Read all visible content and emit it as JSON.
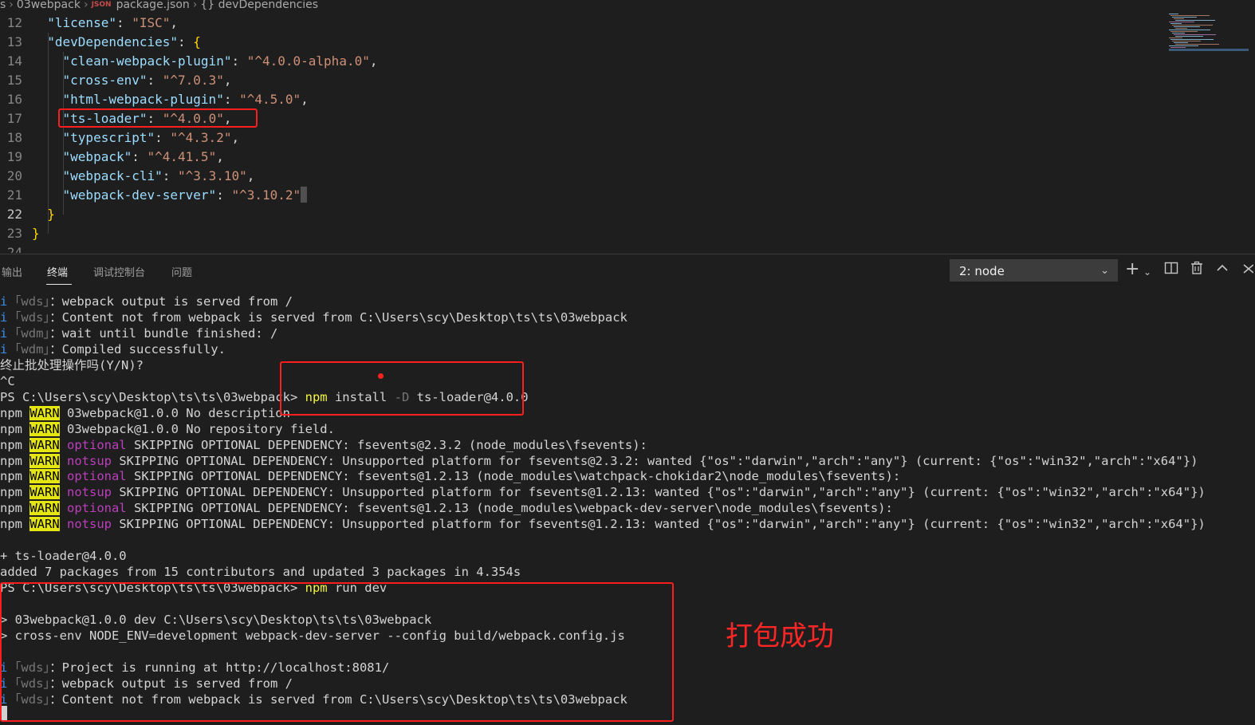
{
  "breadcrumb": {
    "seg1": "s",
    "seg2": "03webpack",
    "file_icon": "JSON",
    "file": "package.json",
    "node_icon": "{}",
    "node": "devDependencies"
  },
  "editor": {
    "lines": [
      {
        "n": "12",
        "code": [
          [
            "k",
            "  \"license\""
          ],
          [
            "p",
            ": "
          ],
          [
            "s",
            "\"ISC\""
          ],
          [
            "p",
            ","
          ]
        ]
      },
      {
        "n": "13",
        "code": [
          [
            "k",
            "  \"devDependencies\""
          ],
          [
            "p",
            ": "
          ],
          [
            "b",
            "{"
          ]
        ]
      },
      {
        "n": "14",
        "code": [
          [
            "k",
            "    \"clean-webpack-plugin\""
          ],
          [
            "p",
            ": "
          ],
          [
            "s",
            "\"^4.0.0-alpha.0\""
          ],
          [
            "p",
            ","
          ]
        ]
      },
      {
        "n": "15",
        "code": [
          [
            "k",
            "    \"cross-env\""
          ],
          [
            "p",
            ": "
          ],
          [
            "s",
            "\"^7.0.3\""
          ],
          [
            "p",
            ","
          ]
        ]
      },
      {
        "n": "16",
        "code": [
          [
            "k",
            "    \"html-webpack-plugin\""
          ],
          [
            "p",
            ": "
          ],
          [
            "s",
            "\"^4.5.0\""
          ],
          [
            "p",
            ","
          ]
        ]
      },
      {
        "n": "17",
        "code": [
          [
            "k",
            "    \"ts-loader\""
          ],
          [
            "p",
            ": "
          ],
          [
            "s",
            "\"^4.0.0\""
          ],
          [
            "p",
            ","
          ]
        ]
      },
      {
        "n": "18",
        "code": [
          [
            "k",
            "    \"typescript\""
          ],
          [
            "p",
            ": "
          ],
          [
            "s",
            "\"^4.3.2\""
          ],
          [
            "p",
            ","
          ]
        ]
      },
      {
        "n": "19",
        "code": [
          [
            "k",
            "    \"webpack\""
          ],
          [
            "p",
            ": "
          ],
          [
            "s",
            "\"^4.41.5\""
          ],
          [
            "p",
            ","
          ]
        ]
      },
      {
        "n": "20",
        "code": [
          [
            "k",
            "    \"webpack-cli\""
          ],
          [
            "p",
            ": "
          ],
          [
            "s",
            "\"^3.3.10\""
          ],
          [
            "p",
            ","
          ]
        ]
      },
      {
        "n": "21",
        "code": [
          [
            "k",
            "    \"webpack-dev-server\""
          ],
          [
            "p",
            ": "
          ],
          [
            "s",
            "\"^3.10.2\""
          ]
        ]
      },
      {
        "n": "22",
        "code": [
          [
            "p",
            "  "
          ],
          [
            "b",
            "}"
          ]
        ]
      },
      {
        "n": "23",
        "code": [
          [
            "b",
            "}"
          ]
        ]
      },
      {
        "n": "24",
        "code": []
      }
    ]
  },
  "panel": {
    "tabs": [
      "输出",
      "终端",
      "调试控制台",
      "问题"
    ],
    "active_tab": "终端",
    "terminal_select": "2: node",
    "icons": [
      "plus-icon",
      "chevron-down-icon",
      "split-terminal-icon",
      "trash-icon",
      "chevron-up-icon",
      "close-icon"
    ]
  },
  "terminal": {
    "lines": [
      [
        [
          "info",
          "i"
        ],
        [
          "dim",
          " ｢wds｣"
        ],
        [
          "",
          "：webpack output is served from /"
        ]
      ],
      [
        [
          "info",
          "i"
        ],
        [
          "dim",
          " ｢wds｣"
        ],
        [
          "",
          "：Content not from webpack is served from C:\\Users\\scy\\Desktop\\ts\\ts\\03webpack"
        ]
      ],
      [
        [
          "info",
          "i"
        ],
        [
          "dim",
          " ｢wdm｣"
        ],
        [
          "",
          "：wait until bundle finished: /"
        ]
      ],
      [
        [
          "info",
          "i"
        ],
        [
          "dim",
          " ｢wdm｣"
        ],
        [
          "",
          "：Compiled successfully."
        ]
      ],
      [
        [
          "",
          "终止批处理操作吗(Y/N)?"
        ]
      ],
      [
        [
          "",
          "^C"
        ]
      ],
      [
        [
          "",
          "PS C:\\Users\\scy\\Desktop\\ts\\ts\\03webpack> "
        ],
        [
          "yel",
          "npm"
        ],
        [
          "",
          " install "
        ],
        [
          "dim",
          "-D"
        ],
        [
          "",
          " ts-loader@4.0.0"
        ]
      ],
      [
        [
          "",
          "npm "
        ],
        [
          "warnbg",
          "WARN"
        ],
        [
          "",
          " 03webpack@1.0.0 No description"
        ]
      ],
      [
        [
          "",
          "npm "
        ],
        [
          "warnbg",
          "WARN"
        ],
        [
          "",
          " 03webpack@1.0.0 No repository field."
        ]
      ],
      [
        [
          "",
          "npm "
        ],
        [
          "warnbg",
          "WARN"
        ],
        [
          "opt",
          " optional"
        ],
        [
          "",
          " SKIPPING OPTIONAL DEPENDENCY: fsevents@2.3.2 (node_modules\\fsevents):"
        ]
      ],
      [
        [
          "",
          "npm "
        ],
        [
          "warnbg",
          "WARN"
        ],
        [
          "opt",
          " notsup"
        ],
        [
          "",
          " SKIPPING OPTIONAL DEPENDENCY: Unsupported platform for fsevents@2.3.2: wanted {\"os\":\"darwin\",\"arch\":\"any\"} (current: {\"os\":\"win32\",\"arch\":\"x64\"})"
        ]
      ],
      [
        [
          "",
          "npm "
        ],
        [
          "warnbg",
          "WARN"
        ],
        [
          "opt",
          " optional"
        ],
        [
          "",
          " SKIPPING OPTIONAL DEPENDENCY: fsevents@1.2.13 (node_modules\\watchpack-chokidar2\\node_modules\\fsevents):"
        ]
      ],
      [
        [
          "",
          "npm "
        ],
        [
          "warnbg",
          "WARN"
        ],
        [
          "opt",
          " notsup"
        ],
        [
          "",
          " SKIPPING OPTIONAL DEPENDENCY: Unsupported platform for fsevents@1.2.13: wanted {\"os\":\"darwin\",\"arch\":\"any\"} (current: {\"os\":\"win32\",\"arch\":\"x64\"})"
        ]
      ],
      [
        [
          "",
          "npm "
        ],
        [
          "warnbg",
          "WARN"
        ],
        [
          "opt",
          " optional"
        ],
        [
          "",
          " SKIPPING OPTIONAL DEPENDENCY: fsevents@1.2.13 (node_modules\\webpack-dev-server\\node_modules\\fsevents):"
        ]
      ],
      [
        [
          "",
          "npm "
        ],
        [
          "warnbg",
          "WARN"
        ],
        [
          "opt",
          " notsup"
        ],
        [
          "",
          " SKIPPING OPTIONAL DEPENDENCY: Unsupported platform for fsevents@1.2.13: wanted {\"os\":\"darwin\",\"arch\":\"any\"} (current: {\"os\":\"win32\",\"arch\":\"x64\"})"
        ]
      ],
      [],
      [
        [
          "",
          "+ ts-loader@4.0.0"
        ]
      ],
      [
        [
          "",
          "added 7 packages from 15 contributors and updated 3 packages in 4.354s"
        ]
      ],
      [
        [
          "",
          "PS C:\\Users\\scy\\Desktop\\ts\\ts\\03webpack> "
        ],
        [
          "yel",
          "npm"
        ],
        [
          "",
          " run dev"
        ]
      ],
      [],
      [
        [
          "",
          "> 03webpack@1.0.0 dev C:\\Users\\scy\\Desktop\\ts\\ts\\03webpack"
        ]
      ],
      [
        [
          "",
          "> cross-env NODE_ENV=development webpack-dev-server --config build/webpack.config.js"
        ]
      ],
      [],
      [
        [
          "info",
          "i"
        ],
        [
          "dim",
          " ｢wds｣"
        ],
        [
          "",
          "：Project is running at http://localhost:8081/"
        ]
      ],
      [
        [
          "info",
          "i"
        ],
        [
          "dim",
          " ｢wds｣"
        ],
        [
          "",
          "：webpack output is served from /"
        ]
      ],
      [
        [
          "info",
          "i"
        ],
        [
          "dim",
          " ｢wds｣"
        ],
        [
          "",
          "：Content not from webpack is served from C:\\Users\\scy\\Desktop\\ts\\ts\\03webpack"
        ]
      ]
    ]
  },
  "annotation": {
    "text": "打包成功",
    "color": "#ff2626"
  },
  "colors": {
    "highlight_box": "#ff1e1e",
    "warn_bg": "#e5e510",
    "info": "#3b8eea",
    "optional": "#bc3fbc",
    "npm": "#f5f543"
  }
}
